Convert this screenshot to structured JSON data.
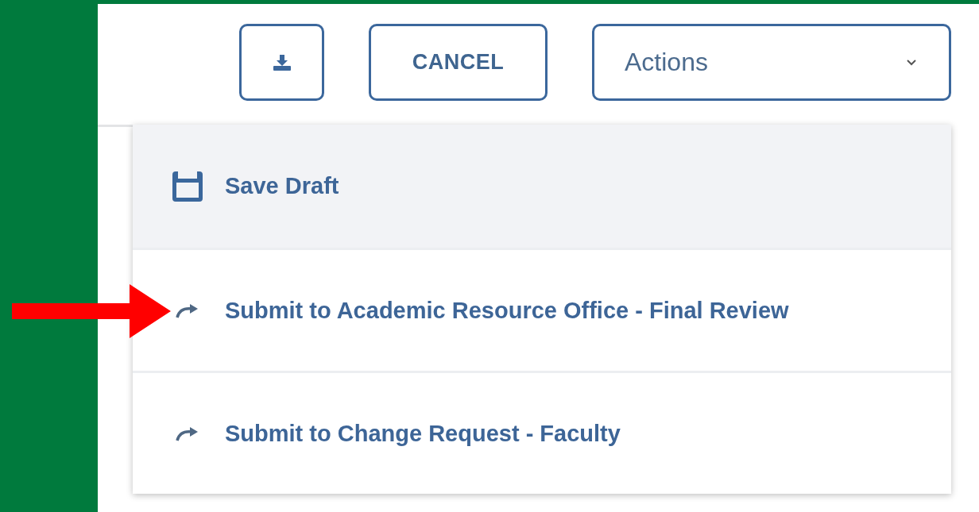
{
  "toolbar": {
    "download_button": {
      "kind": "download"
    },
    "cancel_button": {
      "label": "CANCEL"
    },
    "actions_select": {
      "value": "Actions",
      "expanded": true
    }
  },
  "actions_menu": [
    {
      "label": "Save Draft",
      "kind": "save",
      "highlighted": true,
      "pointed_at": false
    },
    {
      "label": "Submit to Academic Resource Office - Final Review",
      "kind": "submit",
      "highlighted": false,
      "pointed_at": true
    },
    {
      "label": "Submit to Change Request - Faculty",
      "kind": "submit",
      "highlighted": false,
      "pointed_at": false
    }
  ]
}
